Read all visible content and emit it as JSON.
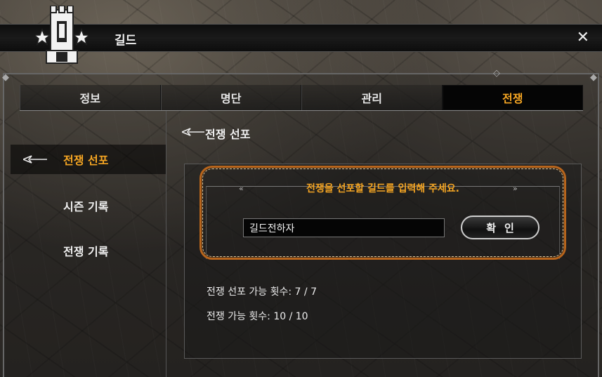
{
  "window": {
    "title": "길드",
    "close_label": "✕"
  },
  "tabs": [
    {
      "label": "정보",
      "active": false
    },
    {
      "label": "명단",
      "active": false
    },
    {
      "label": "관리",
      "active": false
    },
    {
      "label": "전쟁",
      "active": true
    }
  ],
  "sidebar": {
    "items": [
      {
        "label": "전쟁 선포",
        "active": true
      },
      {
        "label": "시즌 기록",
        "active": false
      },
      {
        "label": "전쟁 기록",
        "active": false
      }
    ]
  },
  "content": {
    "title": "전쟁 선포",
    "prompt": "전쟁을 선포할 길드를 입력해 주세요.",
    "guild_input_value": "길드전하자",
    "confirm_label": "확인",
    "declare_remaining": "전쟁 선포 가능 횟수: 7 / 7",
    "war_remaining": "전쟁 가능 횟수: 10 / 10"
  },
  "colors": {
    "accent": "#f6a623",
    "highlight_border": "#b8651c"
  }
}
